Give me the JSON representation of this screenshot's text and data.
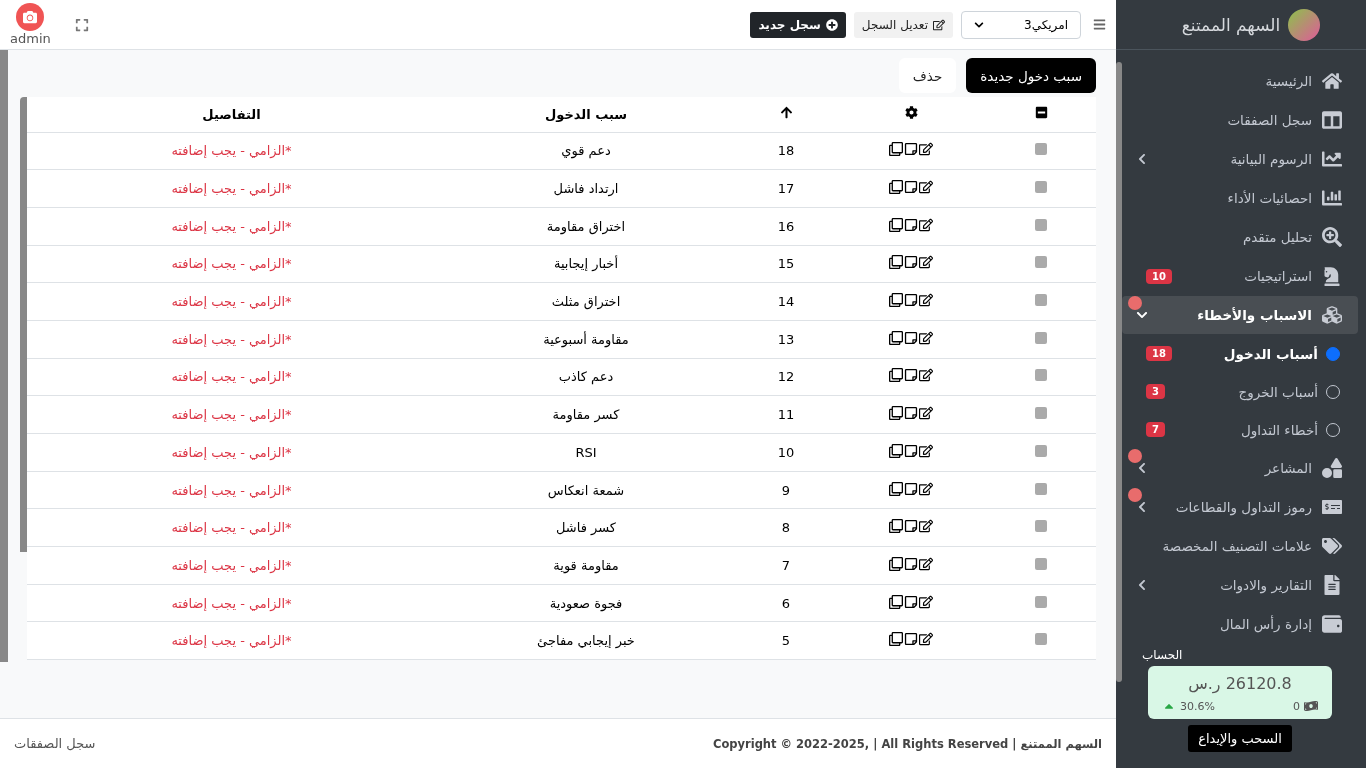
{
  "header": {
    "user": {
      "name": "admin"
    },
    "buttons": [
      {
        "label": "تعديل السجل",
        "kind": "secondary"
      },
      {
        "label": "سجل جديد",
        "kind": "primary"
      }
    ],
    "account_select": {
      "value": "امريكي3"
    }
  },
  "toolbar": {
    "buttons": [
      {
        "label": "سبب دخول جديدة",
        "kind": "primary"
      },
      {
        "label": "حذف",
        "kind": "plain"
      }
    ]
  },
  "table": {
    "select_all": {
      "indeterminate": true
    },
    "columns": [
      "سبب الدخول",
      "التفاصيل"
    ],
    "rows": [
      {
        "number": "18",
        "reason": "دعم قوي",
        "details": "*الزامي - يجب إضافته",
        "checked": false
      },
      {
        "number": "17",
        "reason": "ارتداد فاشل",
        "details": "*الزامي - يجب إضافته",
        "checked": false
      },
      {
        "number": "16",
        "reason": "اختراق مقاومة",
        "details": "*الزامي - يجب إضافته",
        "checked": false
      },
      {
        "number": "15",
        "reason": "أخبار إيجابية",
        "details": "*الزامي - يجب إضافته",
        "checked": false
      },
      {
        "number": "14",
        "reason": "اختراق مثلث",
        "details": "*الزامي - يجب إضافته",
        "checked": false
      },
      {
        "number": "13",
        "reason": "مقاومة أسبوعية",
        "details": "*الزامي - يجب إضافته",
        "checked": false
      },
      {
        "number": "12",
        "reason": "دعم كاذب",
        "details": "*الزامي - يجب إضافته",
        "checked": false
      },
      {
        "number": "11",
        "reason": "كسر مقاومة",
        "details": "*الزامي - يجب إضافته",
        "checked": false
      },
      {
        "number": "10",
        "reason": "RSI",
        "details": "*الزامي - يجب إضافته",
        "checked": false
      },
      {
        "number": "9",
        "reason": "شمعة انعكاس",
        "details": "*الزامي - يجب إضافته",
        "checked": false
      },
      {
        "number": "8",
        "reason": "كسر فاشل",
        "details": "*الزامي - يجب إضافته",
        "checked": false
      },
      {
        "number": "7",
        "reason": "مقاومة قوية",
        "details": "*الزامي - يجب إضافته",
        "checked": false
      },
      {
        "number": "6",
        "reason": "فجوة صعودية",
        "details": "*الزامي - يجب إضافته",
        "checked": false
      },
      {
        "number": "5",
        "reason": "خبر إيجابي مفاجئ",
        "details": "*الزامي - يجب إضافته",
        "checked": false
      }
    ]
  },
  "footer": {
    "copyright": "السهم الممتنع | Copyright © 2022-2025, | All Rights Reserved",
    "breadcrumb": "سجل الصفقات"
  },
  "sidebar": {
    "brand": "السهم الممتنع",
    "items": [
      {
        "label": "الرئيسية",
        "selected": false
      },
      {
        "label": "سجل الصفقات",
        "selected": false
      },
      {
        "label": "الرسوم البيانية",
        "selected": false,
        "expanded": false
      },
      {
        "label": "احصائيات الأداء",
        "selected": false
      },
      {
        "label": "تحليل متقدم",
        "selected": false
      },
      {
        "label": "استراتيجيات",
        "selected": false,
        "badge": "10"
      },
      {
        "label": "الاسباب والأخطاء",
        "selected": true,
        "expanded": true,
        "alert": true,
        "children": [
          {
            "label": "أسباب الدخول",
            "selected": true,
            "badge": "18"
          },
          {
            "label": "أسباب الخروج",
            "selected": false,
            "badge": "3"
          },
          {
            "label": "أخطاء التداول",
            "selected": false,
            "badge": "7"
          }
        ]
      },
      {
        "label": "المشاعر",
        "selected": false,
        "expanded": false,
        "alert": true
      },
      {
        "label": "رموز التداول والقطاعات",
        "selected": false,
        "expanded": false,
        "alert": true
      },
      {
        "label": "علامات التصنيف المخصصة",
        "selected": false
      },
      {
        "label": "التقارير والادوات",
        "selected": false,
        "expanded": false
      },
      {
        "label": "إدارة رأس المال",
        "selected": false
      }
    ],
    "account": {
      "heading": "الحساب",
      "balance": "26120.8 ر.س",
      "change": "30.6%",
      "count": "0"
    },
    "action": "السحب والإيداع"
  }
}
